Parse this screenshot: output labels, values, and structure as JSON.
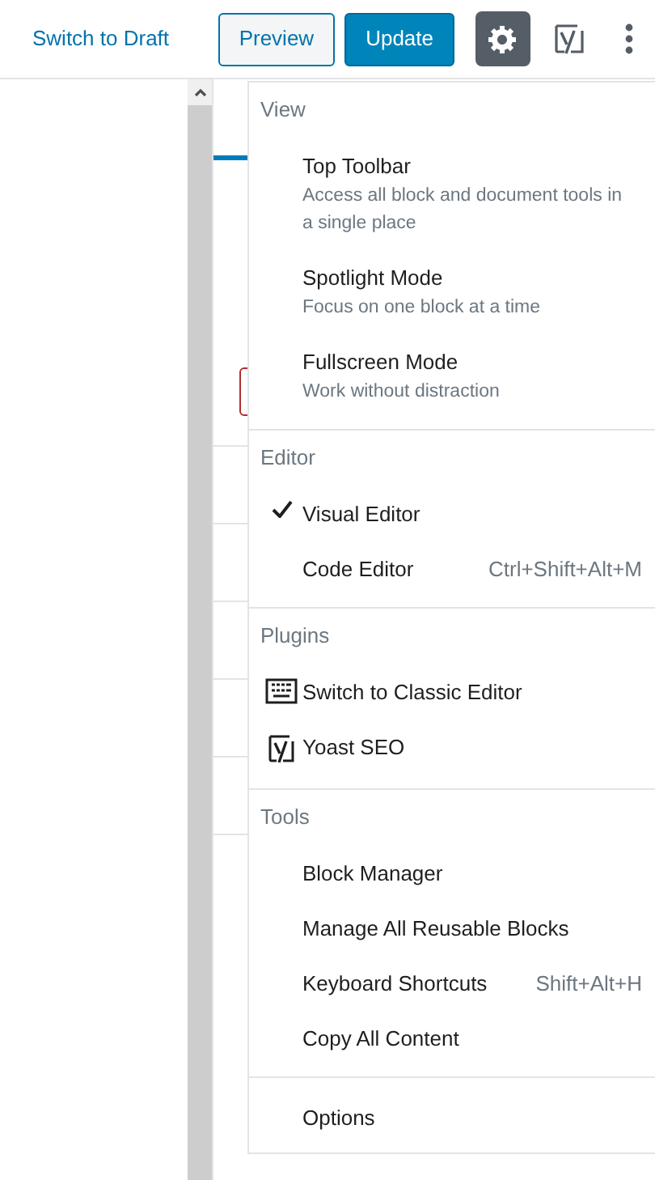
{
  "top_bar": {
    "switch_link": "Switch to Draft",
    "preview_button": "Preview",
    "update_button": "Update",
    "settings_pressed": true
  },
  "sidebar": {
    "tab": {
      "selected": true
    },
    "items": [
      {
        "kind": "field"
      }
    ]
  },
  "menu": {
    "groups": [
      {
        "heading": "View",
        "items": [
          {
            "label": "Top Toolbar",
            "description": "Access all block and document tools in a single place"
          },
          {
            "label": "Spotlight Mode",
            "description": "Focus on one block at a time"
          },
          {
            "label": "Fullscreen Mode",
            "description": "Work without distraction"
          }
        ]
      },
      {
        "heading": "Editor",
        "items": [
          {
            "label": "Visual Editor",
            "checked": true
          },
          {
            "label": "Code Editor",
            "checked": false,
            "shortcut": "Ctrl+Shift+Alt+M"
          }
        ]
      },
      {
        "heading": "Plugins",
        "items": [
          {
            "label": "Switch to Classic Editor",
            "kind": "keyboard"
          },
          {
            "label": "Yoast SEO",
            "kind": "yoast"
          }
        ]
      },
      {
        "heading": "Tools",
        "items": [
          {
            "label": "Block Manager"
          },
          {
            "label": "Manage All Reusable Blocks"
          },
          {
            "label": "Keyboard Shortcuts",
            "shortcut": "Shift+Alt+H"
          },
          {
            "label": "Copy All Content"
          }
        ]
      },
      {
        "items": [
          {
            "label": "Options"
          }
        ]
      }
    ]
  }
}
